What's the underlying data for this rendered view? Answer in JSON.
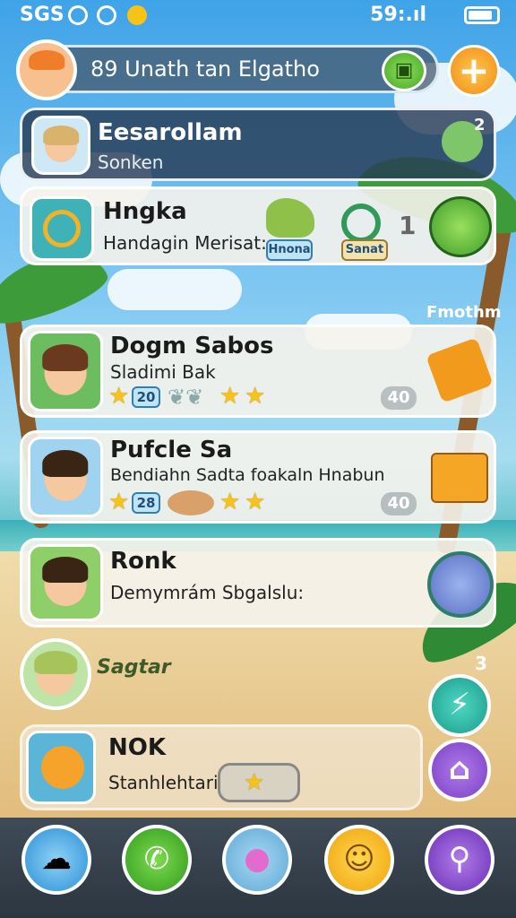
{
  "status_bar": {
    "left_text": "SGS",
    "right_text": "59:.ıl"
  },
  "top_bar": {
    "title": "89 Unath tan Elgatho",
    "action_icon": "bag-icon",
    "plus_label": "+"
  },
  "cards": [
    {
      "id": "eesarollam",
      "title": "Eesarollam",
      "subtitle": "Sonken",
      "corner_badge": "2"
    },
    {
      "id": "hngka",
      "title": "Hngka",
      "subtitle": "Handagin Merisat:",
      "item1_label": "Hnona",
      "item2_label": "Sanat",
      "count": "1"
    },
    {
      "id": "dogm-sabos",
      "title": "Dogm Sabos",
      "subtitle": "Sladimi Bak",
      "badge": "20",
      "level": "40"
    },
    {
      "id": "pufcle-sa",
      "title": "Pufcle Sa",
      "subtitle": "Bendiahn Sadta foakaln Hnabun",
      "badge": "28",
      "level": "40"
    },
    {
      "id": "ronk",
      "title": "Ronk",
      "subtitle": "Demymrám Sbgalslu:"
    },
    {
      "id": "sagtar",
      "title": "Sagtar",
      "corner_badge": "3"
    },
    {
      "id": "nok",
      "title": "NOK",
      "subtitle": "Stanhlehtari"
    }
  ],
  "section_label": "Fmothm",
  "fab": {
    "bolt_icon": "lightning-icon",
    "home_icon": "home-icon"
  },
  "bottom_nav": [
    {
      "name": "chat-icon",
      "glyph": "☁"
    },
    {
      "name": "phone-icon",
      "glyph": "✆"
    },
    {
      "name": "monster-icon",
      "glyph": "●"
    },
    {
      "name": "sun-icon",
      "glyph": "☺"
    },
    {
      "name": "search-icon",
      "glyph": "⚲"
    }
  ],
  "colors": {
    "accent_green": "#46a624",
    "accent_orange": "#f08c17",
    "fab_teal": "#22b3a0",
    "fab_purple": "#8c4fd3"
  }
}
